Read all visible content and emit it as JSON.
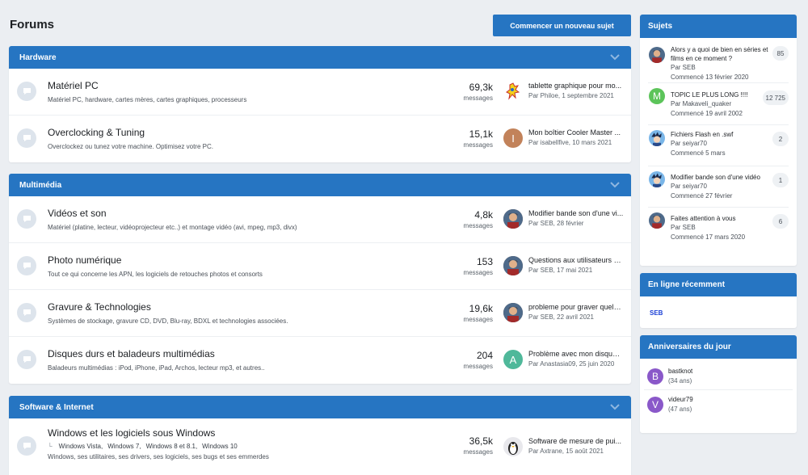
{
  "page": {
    "title": "Forums",
    "new_topic_label": "Commencer un nouveau sujet"
  },
  "colors": {
    "accent": "#2675c2",
    "background": "#ebeef2",
    "online_user": "#1a3fd6"
  },
  "categories": [
    {
      "name": "Hardware",
      "forums": [
        {
          "title": "Matériel PC",
          "desc": "Matériel PC, hardware, cartes mères, cartes graphiques, processeurs",
          "count": "69,3k",
          "count_label": "messages",
          "last_title": "tablette graphique pour mo...",
          "last_meta": "Par Philoe, 1 septembre 2021",
          "avatar": "cartoon-avatar"
        },
        {
          "title": "Overclocking & Tuning",
          "desc": "Overclockez ou tunez votre machine. Optimisez votre PC.",
          "count": "15,1k",
          "count_label": "messages",
          "last_title": "Mon boîtier Cooler Master ...",
          "last_meta": "Par isabellfive, 10 mars 2021",
          "avatar": "letter-I"
        }
      ]
    },
    {
      "name": "Multimédia",
      "forums": [
        {
          "title": "Vidéos et son",
          "desc": "Matériel (platine, lecteur, vidéoprojecteur etc..) et montage vidéo (avi, mpeg, mp3, divx)",
          "count": "4,8k",
          "count_label": "messages",
          "last_title": "Modifier bande son d'une vi...",
          "last_meta": "Par SEB, 28 février",
          "avatar": "photo-avatar"
        },
        {
          "title": "Photo numérique",
          "desc": "Tout ce qui concerne les APN, les logiciels de retouches photos et consorts",
          "count": "153",
          "count_label": "messages",
          "last_title": "Questions aux utilisateurs d...",
          "last_meta": "Par SEB, 17 mai 2021",
          "avatar": "photo-avatar"
        },
        {
          "title": "Gravure & Technologies",
          "desc": "Systèmes de stockage, gravure CD, DVD, Blu-ray, BDXL et technologies associées.",
          "count": "19,6k",
          "count_label": "messages",
          "last_title": "probleme pour graver quelq...",
          "last_meta": "Par SEB, 22 avril 2021",
          "avatar": "photo-avatar"
        },
        {
          "title": "Disques durs et baladeurs multimédias",
          "desc": "Baladeurs multimédias : iPod, iPhone, iPad, Archos, lecteur mp3, et autres..",
          "count": "204",
          "count_label": "messages",
          "last_title": "Problème avec mon disque ...",
          "last_meta": "Par Anastasia09, 25 juin 2020",
          "avatar": "letter-A"
        }
      ]
    },
    {
      "name": "Software & Internet",
      "forums": [
        {
          "title": "Windows et les logiciels sous Windows",
          "subforums": [
            "Windows Vista,",
            "Windows 7,",
            "Windows 8 et 8.1,",
            "Windows 10"
          ],
          "desc": "Windows, ses utilitaires, ses drivers, ses logiciels, ses bugs et ses emmerdes",
          "count": "36,5k",
          "count_label": "messages",
          "last_title": "Software de mesure de pui...",
          "last_meta": "Par Axtrane, 15 août 2021",
          "avatar": "penguin-avatar"
        }
      ]
    }
  ],
  "sidebar": {
    "topics": {
      "title": "Sujets",
      "items": [
        {
          "title": "Alors y a quoi de bien en séries et films en ce moment ?",
          "by": "Par SEB",
          "started": "Commencé 13 février 2020",
          "count": "85",
          "avatar": "photo-avatar"
        },
        {
          "title": "TOPIC LE PLUS LONG !!!!",
          "by": "Par Makaveli_quaker",
          "started": "Commencé 19 avril 2002",
          "count": "12 725",
          "avatar": "letter-M"
        },
        {
          "title": "Fichiers Flash en .swf",
          "by": "Par seiyar70",
          "started": "Commencé 5 mars",
          "count": "2",
          "avatar": "anime-avatar"
        },
        {
          "title": "Modifier bande son d'une vidéo",
          "by": "Par seiyar70",
          "started": "Commencé 27 février",
          "count": "1",
          "avatar": "anime-avatar"
        },
        {
          "title": "Faites attention à vous",
          "by": "Par SEB",
          "started": "Commencé 17 mars 2020",
          "count": "6",
          "avatar": "photo-avatar"
        }
      ]
    },
    "online": {
      "title": "En ligne récemment",
      "users": [
        "SEB"
      ]
    },
    "birthdays": {
      "title": "Anniversaires du jour",
      "items": [
        {
          "initial": "B",
          "name": "bastknot",
          "age": "(34 ans)"
        },
        {
          "initial": "V",
          "name": "videur79",
          "age": "(47 ans)"
        }
      ]
    }
  }
}
